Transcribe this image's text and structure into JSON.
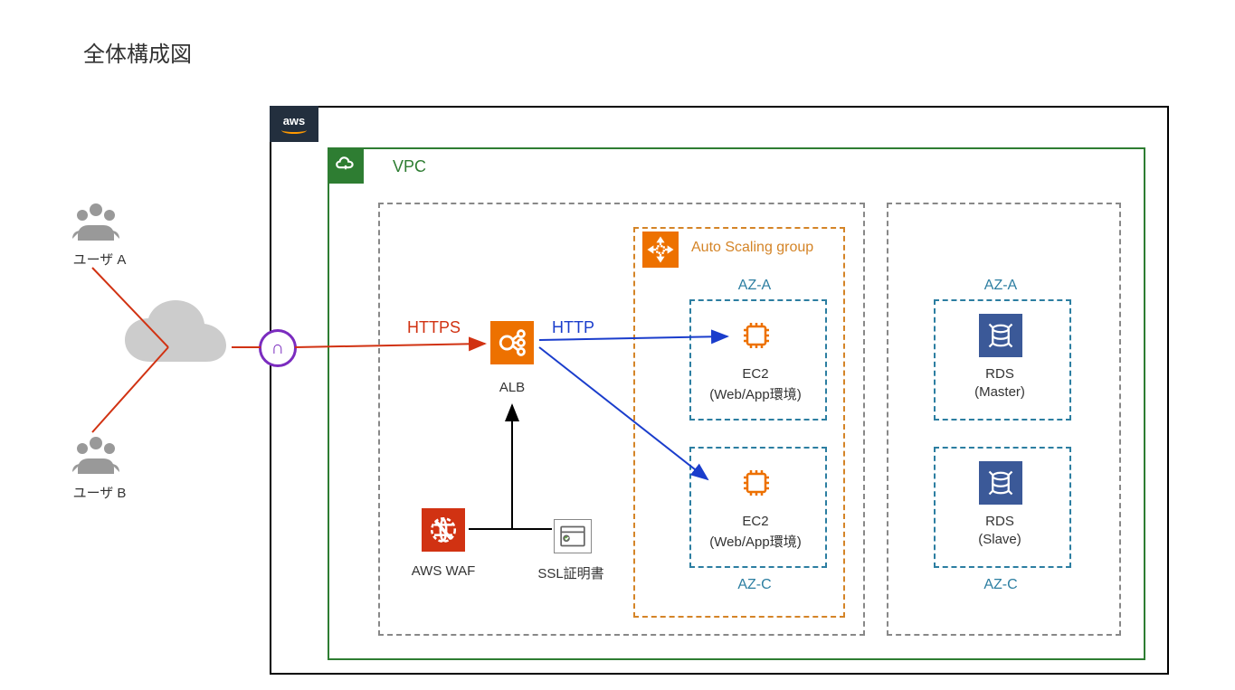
{
  "title": "全体構成図",
  "aws_label": "aws",
  "vpc_label": "VPC",
  "asg_label": "Auto Scaling group",
  "https_label": "HTTPS",
  "http_label": "HTTP",
  "alb_label": "ALB",
  "waf_label": "AWS WAF",
  "ssl_label": "SSL証明書",
  "user_a": "ユーザ A",
  "user_b": "ユーザ B",
  "ec2_title": "EC2",
  "ec2_sub": "(Web/App環境)",
  "rds_title": "RDS",
  "rds_master": "(Master)",
  "rds_slave": "(Slave)",
  "az_a": "AZ-A",
  "az_c": "AZ-C",
  "gateway_symbol": "∩"
}
